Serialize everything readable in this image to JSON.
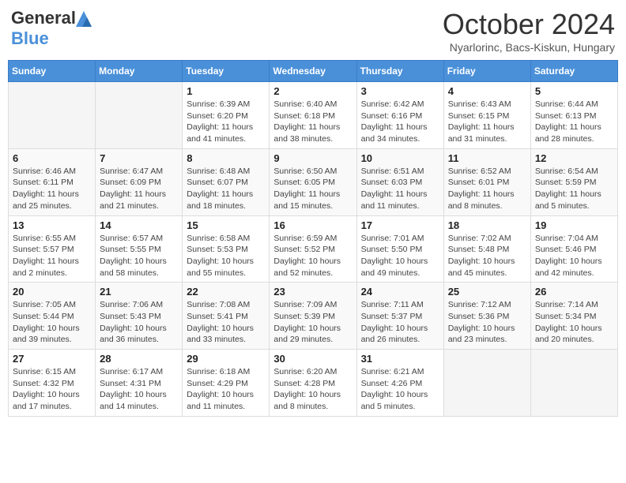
{
  "header": {
    "logo_line1": "General",
    "logo_line2": "Blue",
    "month_title": "October 2024",
    "location": "Nyarlorinc, Bacs-Kiskun, Hungary"
  },
  "weekdays": [
    "Sunday",
    "Monday",
    "Tuesday",
    "Wednesday",
    "Thursday",
    "Friday",
    "Saturday"
  ],
  "weeks": [
    [
      {
        "day": "",
        "info": ""
      },
      {
        "day": "",
        "info": ""
      },
      {
        "day": "1",
        "info": "Sunrise: 6:39 AM\nSunset: 6:20 PM\nDaylight: 11 hours and 41 minutes."
      },
      {
        "day": "2",
        "info": "Sunrise: 6:40 AM\nSunset: 6:18 PM\nDaylight: 11 hours and 38 minutes."
      },
      {
        "day": "3",
        "info": "Sunrise: 6:42 AM\nSunset: 6:16 PM\nDaylight: 11 hours and 34 minutes."
      },
      {
        "day": "4",
        "info": "Sunrise: 6:43 AM\nSunset: 6:15 PM\nDaylight: 11 hours and 31 minutes."
      },
      {
        "day": "5",
        "info": "Sunrise: 6:44 AM\nSunset: 6:13 PM\nDaylight: 11 hours and 28 minutes."
      }
    ],
    [
      {
        "day": "6",
        "info": "Sunrise: 6:46 AM\nSunset: 6:11 PM\nDaylight: 11 hours and 25 minutes."
      },
      {
        "day": "7",
        "info": "Sunrise: 6:47 AM\nSunset: 6:09 PM\nDaylight: 11 hours and 21 minutes."
      },
      {
        "day": "8",
        "info": "Sunrise: 6:48 AM\nSunset: 6:07 PM\nDaylight: 11 hours and 18 minutes."
      },
      {
        "day": "9",
        "info": "Sunrise: 6:50 AM\nSunset: 6:05 PM\nDaylight: 11 hours and 15 minutes."
      },
      {
        "day": "10",
        "info": "Sunrise: 6:51 AM\nSunset: 6:03 PM\nDaylight: 11 hours and 11 minutes."
      },
      {
        "day": "11",
        "info": "Sunrise: 6:52 AM\nSunset: 6:01 PM\nDaylight: 11 hours and 8 minutes."
      },
      {
        "day": "12",
        "info": "Sunrise: 6:54 AM\nSunset: 5:59 PM\nDaylight: 11 hours and 5 minutes."
      }
    ],
    [
      {
        "day": "13",
        "info": "Sunrise: 6:55 AM\nSunset: 5:57 PM\nDaylight: 11 hours and 2 minutes."
      },
      {
        "day": "14",
        "info": "Sunrise: 6:57 AM\nSunset: 5:55 PM\nDaylight: 10 hours and 58 minutes."
      },
      {
        "day": "15",
        "info": "Sunrise: 6:58 AM\nSunset: 5:53 PM\nDaylight: 10 hours and 55 minutes."
      },
      {
        "day": "16",
        "info": "Sunrise: 6:59 AM\nSunset: 5:52 PM\nDaylight: 10 hours and 52 minutes."
      },
      {
        "day": "17",
        "info": "Sunrise: 7:01 AM\nSunset: 5:50 PM\nDaylight: 10 hours and 49 minutes."
      },
      {
        "day": "18",
        "info": "Sunrise: 7:02 AM\nSunset: 5:48 PM\nDaylight: 10 hours and 45 minutes."
      },
      {
        "day": "19",
        "info": "Sunrise: 7:04 AM\nSunset: 5:46 PM\nDaylight: 10 hours and 42 minutes."
      }
    ],
    [
      {
        "day": "20",
        "info": "Sunrise: 7:05 AM\nSunset: 5:44 PM\nDaylight: 10 hours and 39 minutes."
      },
      {
        "day": "21",
        "info": "Sunrise: 7:06 AM\nSunset: 5:43 PM\nDaylight: 10 hours and 36 minutes."
      },
      {
        "day": "22",
        "info": "Sunrise: 7:08 AM\nSunset: 5:41 PM\nDaylight: 10 hours and 33 minutes."
      },
      {
        "day": "23",
        "info": "Sunrise: 7:09 AM\nSunset: 5:39 PM\nDaylight: 10 hours and 29 minutes."
      },
      {
        "day": "24",
        "info": "Sunrise: 7:11 AM\nSunset: 5:37 PM\nDaylight: 10 hours and 26 minutes."
      },
      {
        "day": "25",
        "info": "Sunrise: 7:12 AM\nSunset: 5:36 PM\nDaylight: 10 hours and 23 minutes."
      },
      {
        "day": "26",
        "info": "Sunrise: 7:14 AM\nSunset: 5:34 PM\nDaylight: 10 hours and 20 minutes."
      }
    ],
    [
      {
        "day": "27",
        "info": "Sunrise: 6:15 AM\nSunset: 4:32 PM\nDaylight: 10 hours and 17 minutes."
      },
      {
        "day": "28",
        "info": "Sunrise: 6:17 AM\nSunset: 4:31 PM\nDaylight: 10 hours and 14 minutes."
      },
      {
        "day": "29",
        "info": "Sunrise: 6:18 AM\nSunset: 4:29 PM\nDaylight: 10 hours and 11 minutes."
      },
      {
        "day": "30",
        "info": "Sunrise: 6:20 AM\nSunset: 4:28 PM\nDaylight: 10 hours and 8 minutes."
      },
      {
        "day": "31",
        "info": "Sunrise: 6:21 AM\nSunset: 4:26 PM\nDaylight: 10 hours and 5 minutes."
      },
      {
        "day": "",
        "info": ""
      },
      {
        "day": "",
        "info": ""
      }
    ]
  ]
}
